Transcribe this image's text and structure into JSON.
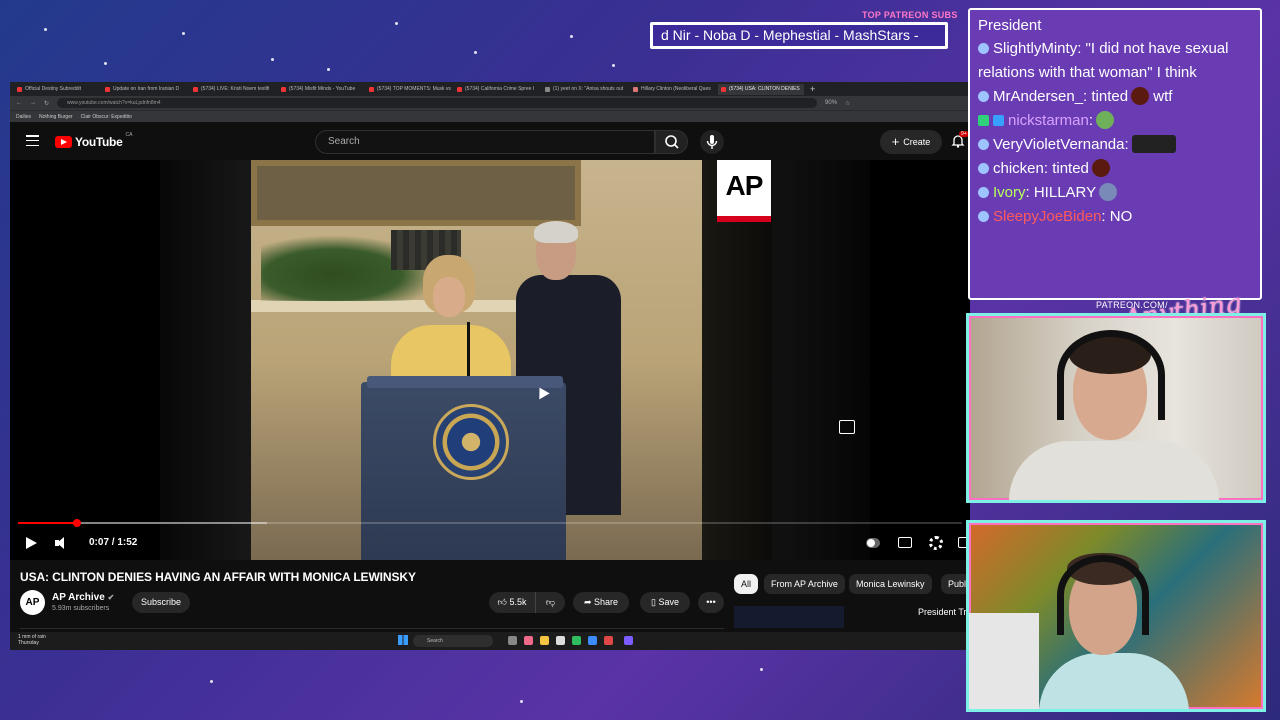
{
  "overlay": {
    "patreon_label": "TOP PATREON SUBS",
    "ticker_text": "d Nir - Noba D - Mephestial - MashStars -",
    "patreon_url": "PATREON.COM/",
    "signature": "Anything Else"
  },
  "browser": {
    "tabs": [
      {
        "label": "Official Destiny Subreddit"
      },
      {
        "label": "Update on Iran from Iranian D"
      },
      {
        "label": "(5734) LIVE: Kristi Noem testifi"
      },
      {
        "label": "(5734) Misfit Minds - YouTube"
      },
      {
        "label": "(5734) TOP MOMENTS: Musk vs"
      },
      {
        "label": "(5734) California Crime Spree I"
      },
      {
        "label": "(1) yeet on X: \"Anisa shouts out"
      },
      {
        "label": "Hillary Clinton (Neoliberal Ques"
      },
      {
        "label": "(5734) USA: CLINTON DENIES"
      }
    ],
    "url": "www.youtube.com/watch?v=kuLpdnfn8m4",
    "zoom": "90%",
    "bookmarks": [
      "Dailies",
      "Nothing Burger",
      "Clair Obscur: Expeditio"
    ]
  },
  "youtube": {
    "logo_text": "YouTube",
    "country": "CA",
    "search_placeholder": "Search",
    "create_label": "Create",
    "notif_count": "9+",
    "player": {
      "ap_logo": "AP",
      "time": "0:07 / 1:52",
      "progress_fraction": 0.062,
      "buffer_fraction": 0.264
    },
    "video_title": "USA: CLINTON DENIES HAVING AN AFFAIR WITH MONICA LEWINSKY",
    "channel": {
      "avatar_text": "AP",
      "name": "AP Archive",
      "subs": "5.93m subscribers",
      "subscribe_label": "Subscribe"
    },
    "actions": {
      "likes": "5.5k",
      "share": "Share",
      "save": "Save"
    },
    "chips": [
      "All",
      "From AP Archive",
      "Monica Lewinsky",
      "Public"
    ],
    "rec_title": "President Tr Participates",
    "taskbar": {
      "weather_line1": "1 mm of rain",
      "weather_line2": "Thursday",
      "search": "Search"
    }
  },
  "chat": {
    "header": "President",
    "messages": [
      {
        "user": "SlightlyMinty",
        "text": ": \"I did not have sexual relations with that woman\" I think",
        "user_color": "#ffffff"
      },
      {
        "user": "MrAndersen_",
        "text": ": tinted",
        "suffix": " wtf",
        "user_color": "#ffffff"
      },
      {
        "user": "nickstarman",
        "text": ":",
        "user_color": "#d9a2ff"
      },
      {
        "user": "VeryVioletVernanda",
        "text": ":",
        "user_color": "#ffffff"
      },
      {
        "user": "chicken",
        "text": ": tinted",
        "user_color": "#ffffff"
      },
      {
        "user": "Ivory",
        "text": ": HILLARY",
        "user_color": "#b6ff5a"
      },
      {
        "user": "SleepyJoeBiden",
        "text": ": NO",
        "user_color": "#ff5a5a"
      }
    ]
  }
}
